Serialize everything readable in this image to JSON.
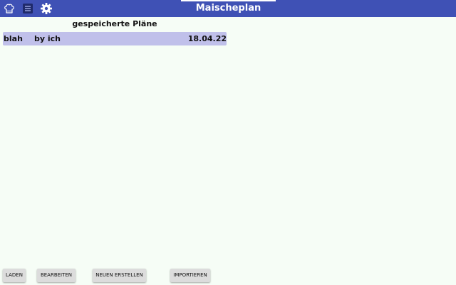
{
  "header": {
    "title": "Maischeplan",
    "icons": [
      "chef-hat-icon",
      "list-icon",
      "gear-icon"
    ],
    "background_color": "#3f51b5"
  },
  "plans": {
    "heading": "gespeicherte Pläne",
    "items": [
      {
        "name": "blah",
        "author": "by ich",
        "date": "18.04.22",
        "selected": true
      }
    ],
    "selected_color": "#c0c0ea"
  },
  "actions": {
    "load_label": "LADEN",
    "edit_label": "BEARBEITEN",
    "create_label": "NEUEN ERSTELLEN",
    "import_label": "IMPORTIEREN"
  }
}
